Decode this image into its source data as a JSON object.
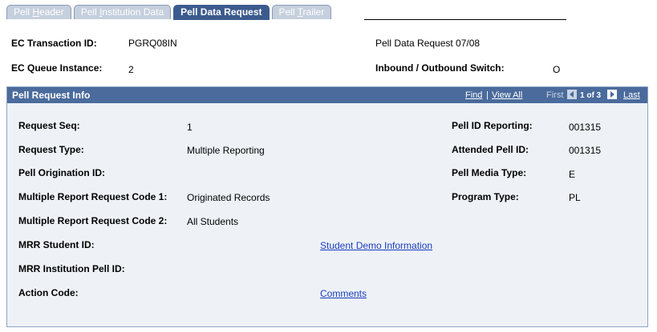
{
  "tabs": [
    {
      "label_pre": "Pell ",
      "label_key": "H",
      "label_post": "eader",
      "active": false
    },
    {
      "label_pre": "Pell ",
      "label_key": "I",
      "label_post": "nstitution Data",
      "active": false
    },
    {
      "label_pre": "Pell Data Request",
      "label_key": "",
      "label_post": "",
      "active": true
    },
    {
      "label_pre": "Pell ",
      "label_key": "T",
      "label_post": "railer",
      "active": false
    }
  ],
  "header": {
    "ec_transaction_id_label": "EC Transaction ID:",
    "ec_transaction_id_value": "PGRQ08IN",
    "ec_queue_instance_label": "EC Queue Instance:",
    "ec_queue_instance_value": "2",
    "request_title": "Pell Data Request 07/08",
    "switch_label": "Inbound / Outbound Switch:",
    "switch_value": "O"
  },
  "panel": {
    "title": "Pell Request Info",
    "find": "Find",
    "separator": "|",
    "view_all": "View All",
    "first": "First",
    "position": "1 of 3",
    "last": "Last",
    "fields": {
      "request_seq_label": "Request Seq:",
      "request_seq_value": "1",
      "request_type_label": "Request Type:",
      "request_type_value": "Multiple Reporting",
      "origination_id_label": "Pell Origination ID:",
      "mrr_code1_label": "Multiple Report Request Code 1:",
      "mrr_code1_value": "Originated Records",
      "mrr_code2_label": "Multiple Report Request Code 2:",
      "mrr_code2_value": "All Students",
      "mrr_student_label": "MRR Student ID:",
      "mrr_institution_label": "MRR Institution Pell ID:",
      "action_code_label": "Action Code:",
      "pell_id_reporting_label": "Pell ID Reporting:",
      "pell_id_reporting_value": "001315",
      "attended_pell_label": "Attended Pell ID:",
      "attended_pell_value": "001315",
      "media_type_label": "Pell Media Type:",
      "media_type_value": "E",
      "program_type_label": "Program Type:",
      "program_type_value": "PL"
    },
    "links": {
      "student_demo": "Student Demo Information",
      "comments": "Comments"
    }
  }
}
